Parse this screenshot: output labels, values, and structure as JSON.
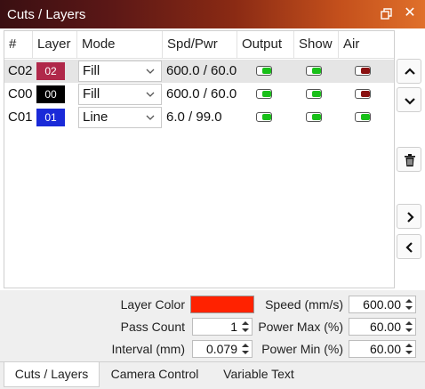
{
  "window": {
    "title": "Cuts / Layers",
    "float_icon": "float-window-icon",
    "close_label": "✕"
  },
  "table": {
    "headers": [
      "#",
      "Layer",
      "Mode",
      "Spd/Pwr",
      "Output",
      "Show",
      "Air"
    ],
    "rows": [
      {
        "id": "C02",
        "layer": "02",
        "color": "#b0284a",
        "mode": "Fill",
        "spd_pwr": "600.0 / 60.0",
        "output": true,
        "show": true,
        "air": false
      },
      {
        "id": "C00",
        "layer": "00",
        "color": "#000000",
        "mode": "Fill",
        "spd_pwr": "600.0 / 60.0",
        "output": true,
        "show": true,
        "air": false
      },
      {
        "id": "C01",
        "layer": "01",
        "color": "#1a2ad8",
        "mode": "Line",
        "spd_pwr": "6.0 / 99.0",
        "output": true,
        "show": true,
        "air": true
      }
    ]
  },
  "side_buttons": [
    "move-up-icon",
    "move-down-icon",
    "delete-icon",
    "expand-right-icon",
    "collapse-left-icon"
  ],
  "props": {
    "layer_color_label": "Layer Color",
    "layer_color": "#ff2200",
    "pass_count_label": "Pass Count",
    "pass_count": "1",
    "interval_label": "Interval (mm)",
    "interval": "0.079",
    "speed_label": "Speed (mm/s)",
    "speed": "600.00",
    "power_max_label": "Power Max (%)",
    "power_max": "60.00",
    "power_min_label": "Power Min (%)",
    "power_min": "60.00"
  },
  "tabs": [
    "Cuts / Layers",
    "Camera Control",
    "Variable Text"
  ]
}
